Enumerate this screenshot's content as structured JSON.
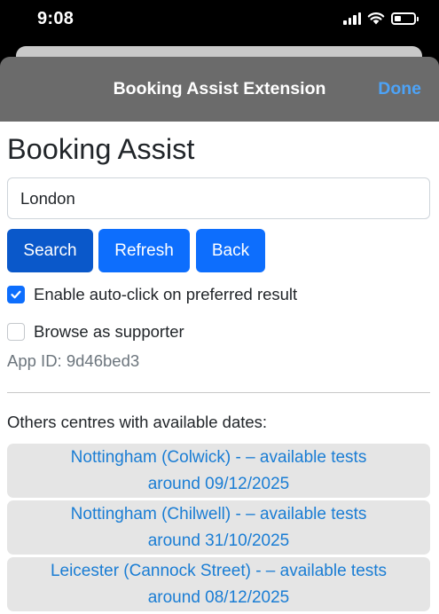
{
  "status_bar": {
    "time": "9:08",
    "icons": [
      "signal-icon",
      "wifi-icon",
      "battery-icon"
    ]
  },
  "header": {
    "title": "Booking Assist Extension",
    "done_label": "Done"
  },
  "main": {
    "heading": "Booking Assist",
    "search": {
      "value": "London"
    },
    "buttons": {
      "search": "Search",
      "refresh": "Refresh",
      "back": "Back"
    },
    "options": [
      {
        "label": "Enable auto-click on preferred result",
        "checked": true
      },
      {
        "label": "Browse as supporter",
        "checked": false
      }
    ],
    "app_id": "App ID: 9d46bed3",
    "others_heading": "Others centres with available dates:",
    "centres": [
      {
        "line1": "Nottingham (Colwick) -  – available tests",
        "line2": "around 09/12/2025"
      },
      {
        "line1": "Nottingham (Chilwell) -  – available tests",
        "line2": "around 31/10/2025"
      },
      {
        "line1": "Leicester (Cannock Street) -  – available tests",
        "line2": "around 08/12/2025"
      }
    ]
  },
  "colors": {
    "primary": "#0d6efd",
    "link": "#1a7dd4",
    "header_bg": "#6b6b6b",
    "done": "#4da3f7"
  }
}
